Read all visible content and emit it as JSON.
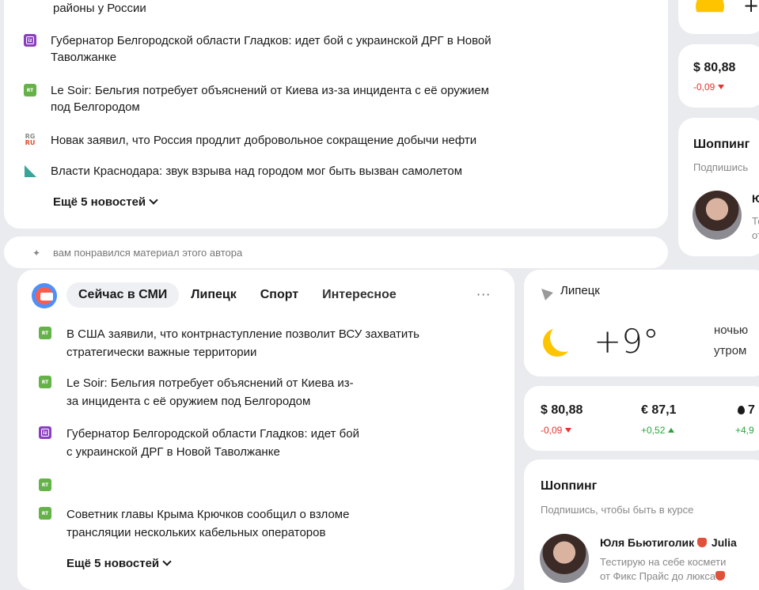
{
  "top_news": {
    "items": [
      {
        "source": "unknown",
        "text": "районы у России",
        "continuation": true
      },
      {
        "source": "iz",
        "text": "Губернатор Белгородской области Гладков: идет бой с украинской ДРГ в Новой",
        "text2": "Таволжанке"
      },
      {
        "source": "rt",
        "text": "Le Soir: Бельгия потребует объяснений от Киева из-за инцидента с её оружием",
        "text2": "под Белгородом"
      },
      {
        "source": "rg",
        "text": "Новак заявил, что Россия продлит добровольное сокращение добычи нефти"
      },
      {
        "source": "kr",
        "text": "Власти Краснодара: звук взрыва над городом мог быть вызван самолетом"
      }
    ],
    "more_label": "Ещё 5 новостей"
  },
  "top_recommend": {
    "text": "вам понравился материал этого автора"
  },
  "top_currency": {
    "usd_value": "$ 80,88",
    "usd_change": "-0,09"
  },
  "top_shopping": {
    "title": "Шоппинг",
    "subtitle": "Подпишись",
    "name_initial": "Ю",
    "desc_line1": "Те",
    "desc_line2": "от"
  },
  "smi": {
    "tabs": [
      "Сейчас в СМИ",
      "Липецк",
      "Спорт",
      "Интересное"
    ],
    "active_tab": "Сейчас в СМИ",
    "more_menu": "···",
    "items": [
      {
        "source": "rt",
        "line1": "В США заявили, что контрнаступление позволит ВСУ захватить",
        "line2": "стратегически важные территории"
      },
      {
        "source": "rt",
        "line1": "Le Soir: Бельгия потребует объяснений от Киева из-",
        "line2": "за инцидента с её оружием под Белгородом"
      },
      {
        "source": "iz",
        "line1": "Губернатор Белгородской области Гладков: идет бой",
        "line2": "с украинской ДРГ в Новой Таволжанке"
      },
      {
        "source": "rt",
        "line1": "",
        "line2": ""
      },
      {
        "source": "rt",
        "line1": "Советник главы Крыма Крючков сообщил о взломе",
        "line2": "трансляции нескольких кабельных операторов"
      }
    ],
    "more_label": "Ещё 5 новостей"
  },
  "weather": {
    "location": "Липецк",
    "temperature": "+9°",
    "night_label": "ночью",
    "morning_label": "утром"
  },
  "currency": {
    "usd": {
      "value": "$ 80,88",
      "change": "-0,09",
      "direction": "down"
    },
    "eur": {
      "value": "€ 87,1",
      "change": "+0,52",
      "direction": "up"
    },
    "oil": {
      "value": "7",
      "change": "+4,9",
      "direction": "up"
    }
  },
  "shopping": {
    "title": "Шоппинг",
    "subtitle": "Подпишись, чтобы быть в курсе",
    "blogger_name": "Юля Бьютиголик",
    "blogger_name_suffix": "Julia",
    "desc_line1": "Тестирую на себе космети",
    "desc_line2": "от Фикс Прайс до люкса"
  },
  "colors": {
    "background": "#e9ebef",
    "rt_green": "#64b248",
    "iz_purple": "#8b3fc0",
    "negative": "#e7322e",
    "positive": "#28a53c"
  }
}
